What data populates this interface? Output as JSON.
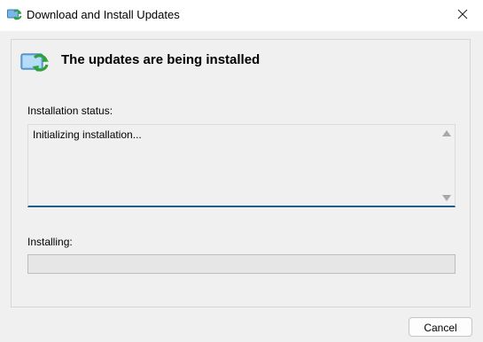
{
  "window": {
    "title": "Download and Install Updates",
    "icon": "windows-update-icon",
    "close_icon": "close-icon"
  },
  "header": {
    "icon": "update-arrows-icon",
    "title": "The updates are being installed"
  },
  "status": {
    "label": "Installation status:",
    "text": "Initializing installation..."
  },
  "installing": {
    "label": "Installing:",
    "progress": 0
  },
  "buttons": {
    "cancel_label": "Cancel"
  },
  "colors": {
    "accent_underline": "#1f5f8b",
    "icon_green": "#3fae3f",
    "icon_blue": "#3a8fd1"
  }
}
